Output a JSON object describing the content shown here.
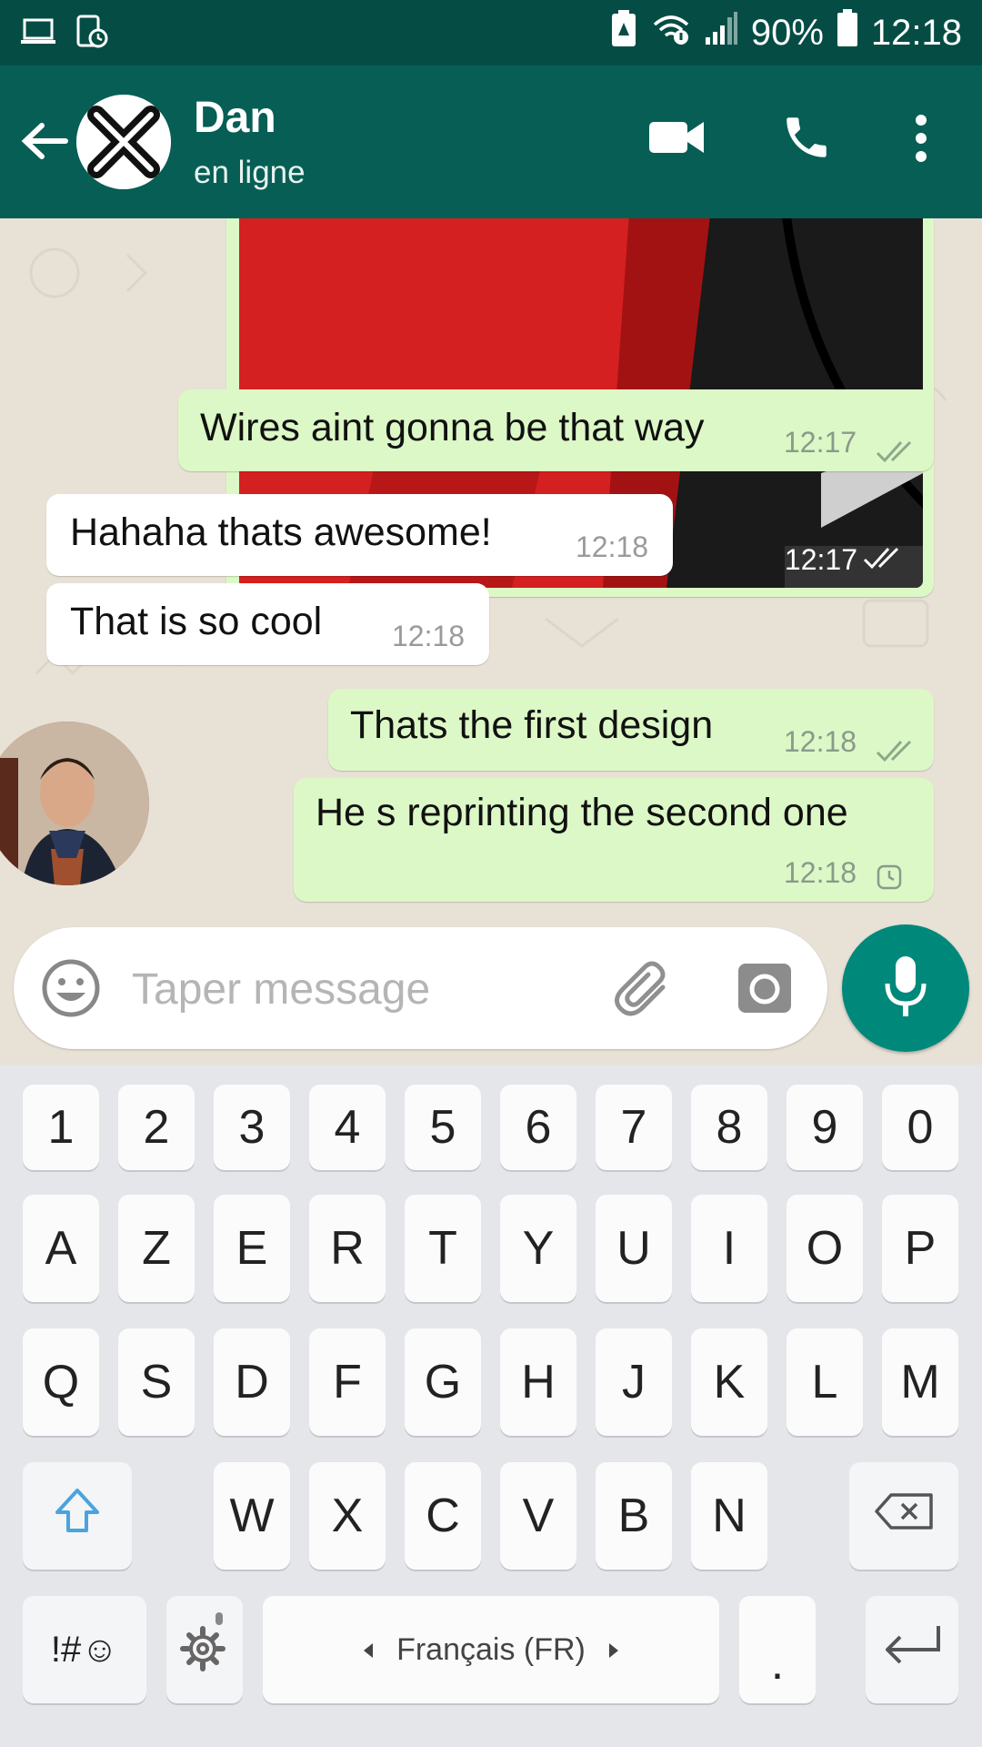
{
  "status_bar": {
    "battery_percent": "90%",
    "time": "12:18",
    "icons": [
      "laptop-icon",
      "screenshot-icon",
      "battery-saver-icon",
      "wifi-icon",
      "signal-icon",
      "battery-icon"
    ]
  },
  "header": {
    "contact_name": "Dan",
    "contact_status": "en ligne",
    "icons": [
      "back-arrow-icon",
      "video-call-icon",
      "phone-icon",
      "more-vert-icon"
    ],
    "color": "#075e54"
  },
  "messages": [
    {
      "type": "image",
      "direction": "outgoing",
      "time": "12:17",
      "status": "read"
    },
    {
      "direction": "outgoing",
      "text": "Wires aint gonna be that way",
      "time": "12:17",
      "status": "read"
    },
    {
      "direction": "incoming",
      "text": "Hahaha thats awesome!",
      "time": "12:18"
    },
    {
      "direction": "incoming",
      "text": "That is so cool",
      "time": "12:18"
    },
    {
      "direction": "outgoing",
      "text": "Thats the first design",
      "time": "12:18",
      "status": "read"
    },
    {
      "direction": "outgoing",
      "text": "He s reprinting the second one",
      "time": "12:18",
      "status": "pending"
    }
  ],
  "input": {
    "placeholder": "Taper message",
    "icons": [
      "emoji-icon",
      "attach-icon",
      "camera-icon",
      "mic-icon"
    ]
  },
  "keyboard": {
    "row_numbers": [
      "1",
      "2",
      "3",
      "4",
      "5",
      "6",
      "7",
      "8",
      "9",
      "0"
    ],
    "row1": [
      "A",
      "Z",
      "E",
      "R",
      "T",
      "Y",
      "U",
      "I",
      "O",
      "P"
    ],
    "row2": [
      "Q",
      "S",
      "D",
      "F",
      "G",
      "H",
      "J",
      "K",
      "L",
      "M"
    ],
    "row3": [
      "W",
      "X",
      "C",
      "V",
      "B",
      "N"
    ],
    "symbols_key": "!#☺",
    "language": "Français (FR)",
    "period": "."
  },
  "colors": {
    "outgoing_bubble": "#dcf8c6",
    "incoming_bubble": "#ffffff",
    "chat_background": "#e8e1d6",
    "mic_button": "#00897b",
    "read_tick": "#4fc3f7"
  }
}
